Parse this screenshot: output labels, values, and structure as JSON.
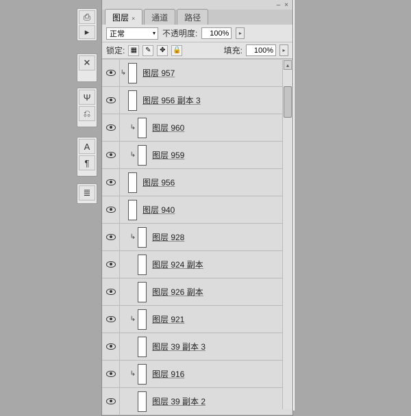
{
  "panel_top": {
    "dash": "–",
    "close": "×"
  },
  "tabs": [
    {
      "label": "图层",
      "active": true
    },
    {
      "label": "通道",
      "active": false
    },
    {
      "label": "路径",
      "active": false
    }
  ],
  "blend": {
    "mode": "正常",
    "opacity_label": "不透明度:",
    "opacity_value": "100%"
  },
  "lock": {
    "label": "锁定:",
    "fill_label": "填充:",
    "fill_value": "100%"
  },
  "layers": [
    {
      "name": "图层 957",
      "clipped": true,
      "indented": false
    },
    {
      "name": "图层 956 副本 3",
      "clipped": false,
      "indented": false
    },
    {
      "name": "图层 960",
      "clipped": true,
      "indented": true
    },
    {
      "name": "图层 959",
      "clipped": true,
      "indented": true
    },
    {
      "name": "图层 956",
      "clipped": false,
      "indented": false
    },
    {
      "name": "图层 940",
      "clipped": false,
      "indented": false
    },
    {
      "name": "图层 928",
      "clipped": true,
      "indented": true
    },
    {
      "name": "图层 924 副本",
      "clipped": false,
      "indented": true
    },
    {
      "name": "图层 926 副本",
      "clipped": false,
      "indented": true
    },
    {
      "name": "图层 921",
      "clipped": true,
      "indented": true
    },
    {
      "name": "图层 39 副本 3",
      "clipped": false,
      "indented": true
    },
    {
      "name": "图层 916",
      "clipped": true,
      "indented": true
    },
    {
      "name": "图层 39 副本 2",
      "clipped": false,
      "indented": true
    }
  ],
  "tool_icons": {
    "c1a": "⎙",
    "c1b": "▸",
    "c2a": "✕",
    "c3a": "Ψ",
    "c3b": "⎌",
    "c4a": "A",
    "c4b": "¶",
    "c5a": "≣"
  }
}
